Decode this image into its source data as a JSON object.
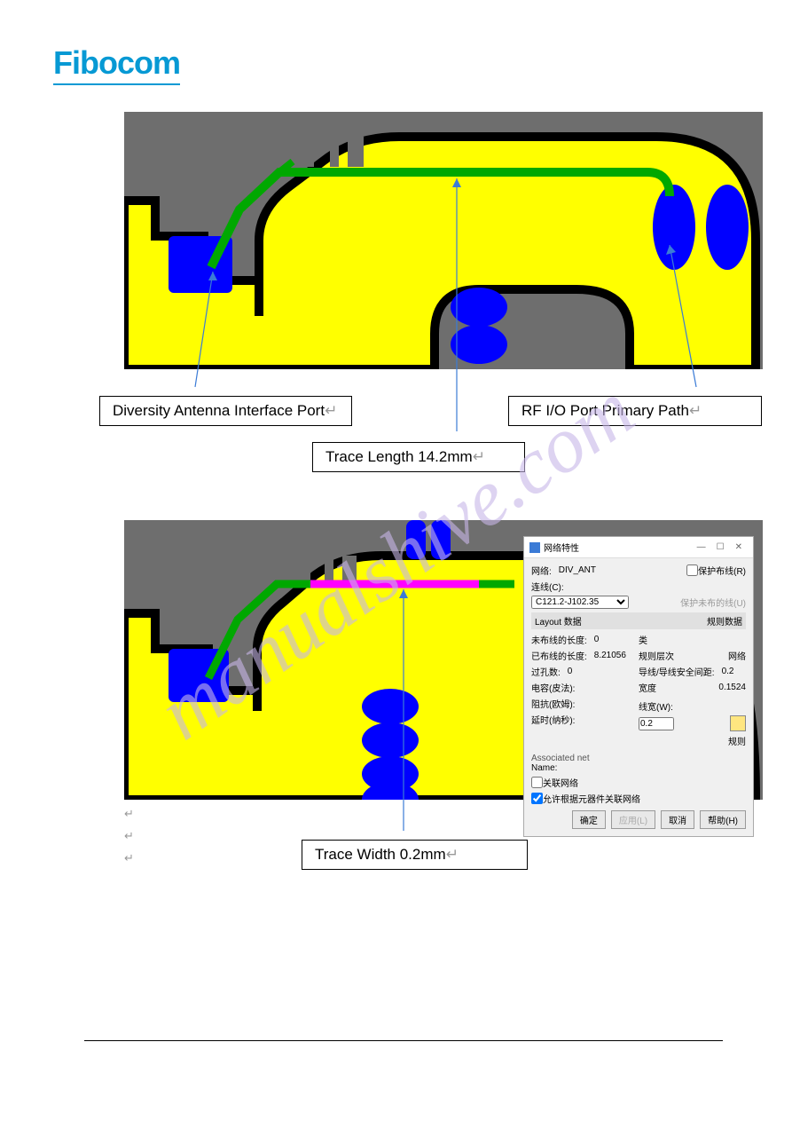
{
  "brand": "Fibocom",
  "watermark": "manualshive.com",
  "figure1": {
    "label_left": "Diversity Antenna Interface Port",
    "label_right": "RF I/O Port Primary Path",
    "label_center": "Trace Length 14.2mm"
  },
  "figure2": {
    "label_bottom": "Trace Width 0.2mm"
  },
  "dialog": {
    "title": "网络特性",
    "net_label": "网络:",
    "net_value": "DIV_ANT",
    "conn_label": "连线(C):",
    "select_value": "C121.2-J102.35",
    "protect_route": "保护布线(R)",
    "protect_unrouted": "保护未布的线(U)",
    "sect_layout": "Layout 数据",
    "sect_rules": "规则数据",
    "unrouted_len_label": "未布线的长度:",
    "unrouted_len_value": "0",
    "routed_len_label": "已布线的长度:",
    "routed_len_value": "8.21056",
    "via_count_label": "过孔数:",
    "via_count_value": "0",
    "cap_label": "电容(皮法):",
    "imp_label": "阻抗(欧姆):",
    "delay_label": "延时(纳秒):",
    "type_label": "类",
    "rule_level_label": "规则层次",
    "net_col": "网络",
    "clearance_label": "导线/导线安全间距:",
    "clearance_value": "0.2",
    "width_label": "宽度",
    "width_value": "0.1524",
    "linewidth_label": "线宽(W):",
    "linewidth_value": "0.2",
    "rules_btn": "规则",
    "assoc_net": "Associated net",
    "name_label": "Name:",
    "assoc_check": "关联网络",
    "allow_check": "允许根据元器件关联网络",
    "ok": "确定",
    "apply": "应用(L)",
    "cancel": "取消",
    "help": "帮助(H)"
  },
  "chart_data": {
    "type": "table",
    "title": "PCB RF Trace Properties",
    "values": {
      "net_name": "DIV_ANT",
      "connection": "C121.2-J102.35",
      "trace_length_mm": 14.2,
      "trace_width_mm": 0.2,
      "routed_length": 8.21056,
      "unrouted_length": 0,
      "via_count": 0,
      "clearance": 0.2,
      "rule_width": 0.1524
    },
    "labels": {
      "port_left": "Diversity Antenna Interface Port",
      "port_right": "RF I/O Port Primary Path"
    }
  }
}
